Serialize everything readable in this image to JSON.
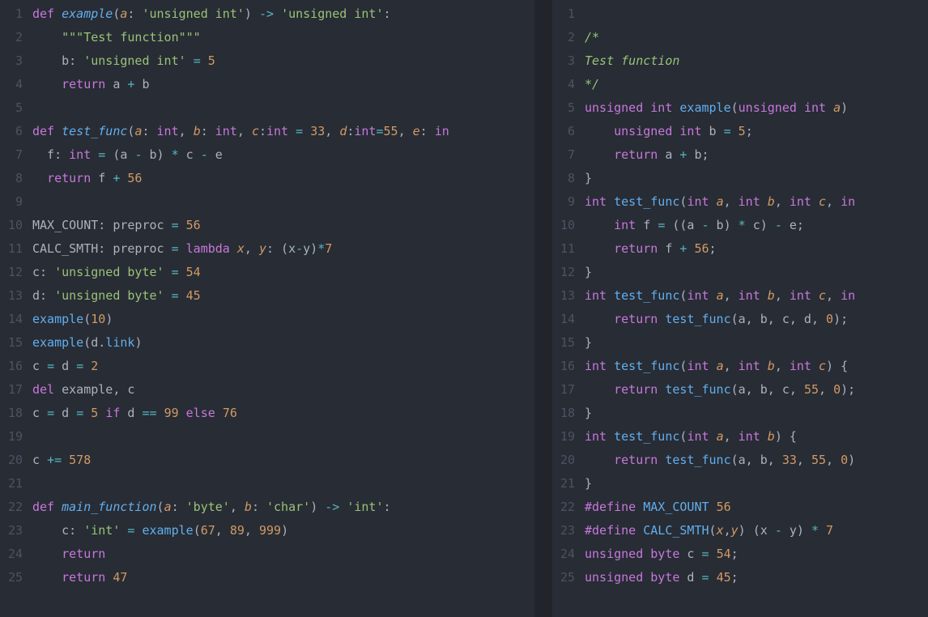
{
  "left": {
    "lang": "python",
    "lines": [
      [
        [
          "kw",
          "def "
        ],
        [
          "fn",
          "example"
        ],
        [
          "var",
          "("
        ],
        [
          "par",
          "a"
        ],
        [
          "var",
          ": "
        ],
        [
          "str",
          "'unsigned int'"
        ],
        [
          "var",
          ") "
        ],
        [
          "op",
          "->"
        ],
        [
          "var",
          " "
        ],
        [
          "str",
          "'unsigned int'"
        ],
        [
          "var",
          ":"
        ]
      ],
      [
        [
          "var",
          "    "
        ],
        [
          "str",
          "\"\"\"Test function\"\"\""
        ]
      ],
      [
        [
          "var",
          "    b: "
        ],
        [
          "str",
          "'unsigned int'"
        ],
        [
          "var",
          " "
        ],
        [
          "op",
          "="
        ],
        [
          "var",
          " "
        ],
        [
          "num",
          "5"
        ]
      ],
      [
        [
          "var",
          "    "
        ],
        [
          "kw",
          "return"
        ],
        [
          "var",
          " a "
        ],
        [
          "op",
          "+"
        ],
        [
          "var",
          " b"
        ]
      ],
      [
        [
          "var",
          ""
        ]
      ],
      [
        [
          "kw",
          "def "
        ],
        [
          "fn",
          "test_func"
        ],
        [
          "var",
          "("
        ],
        [
          "par",
          "a"
        ],
        [
          "var",
          ": "
        ],
        [
          "typ",
          "int"
        ],
        [
          "var",
          ", "
        ],
        [
          "par",
          "b"
        ],
        [
          "var",
          ": "
        ],
        [
          "typ",
          "int"
        ],
        [
          "var",
          ", "
        ],
        [
          "par",
          "c"
        ],
        [
          "var",
          ":"
        ],
        [
          "typ",
          "int"
        ],
        [
          "var",
          " "
        ],
        [
          "op",
          "="
        ],
        [
          "var",
          " "
        ],
        [
          "num",
          "33"
        ],
        [
          "var",
          ", "
        ],
        [
          "par",
          "d"
        ],
        [
          "var",
          ":"
        ],
        [
          "typ",
          "int"
        ],
        [
          "op",
          "="
        ],
        [
          "num",
          "55"
        ],
        [
          "var",
          ", "
        ],
        [
          "par",
          "e"
        ],
        [
          "var",
          ": "
        ],
        [
          "typ",
          "in"
        ]
      ],
      [
        [
          "var",
          "  f: "
        ],
        [
          "typ",
          "int"
        ],
        [
          "var",
          " "
        ],
        [
          "op",
          "="
        ],
        [
          "var",
          " (a "
        ],
        [
          "op",
          "-"
        ],
        [
          "var",
          " b) "
        ],
        [
          "op",
          "*"
        ],
        [
          "var",
          " c "
        ],
        [
          "op",
          "-"
        ],
        [
          "var",
          " e"
        ]
      ],
      [
        [
          "var",
          "  "
        ],
        [
          "kw",
          "return"
        ],
        [
          "var",
          " f "
        ],
        [
          "op",
          "+"
        ],
        [
          "var",
          " "
        ],
        [
          "num",
          "56"
        ]
      ],
      [
        [
          "var",
          ""
        ]
      ],
      [
        [
          "var",
          "MAX_COUNT: preproc "
        ],
        [
          "op",
          "="
        ],
        [
          "var",
          " "
        ],
        [
          "num",
          "56"
        ]
      ],
      [
        [
          "var",
          "CALC_SMTH: preproc "
        ],
        [
          "op",
          "="
        ],
        [
          "var",
          " "
        ],
        [
          "kw",
          "lambda"
        ],
        [
          "var",
          " "
        ],
        [
          "par",
          "x"
        ],
        [
          "var",
          ", "
        ],
        [
          "par",
          "y"
        ],
        [
          "var",
          ": (x"
        ],
        [
          "op",
          "-"
        ],
        [
          "var",
          "y)"
        ],
        [
          "op",
          "*"
        ],
        [
          "num",
          "7"
        ]
      ],
      [
        [
          "var",
          "c: "
        ],
        [
          "str",
          "'unsigned byte'"
        ],
        [
          "var",
          " "
        ],
        [
          "op",
          "="
        ],
        [
          "var",
          " "
        ],
        [
          "num",
          "54"
        ]
      ],
      [
        [
          "var",
          "d: "
        ],
        [
          "str",
          "'unsigned byte'"
        ],
        [
          "var",
          " "
        ],
        [
          "op",
          "="
        ],
        [
          "var",
          " "
        ],
        [
          "num",
          "45"
        ]
      ],
      [
        [
          "call",
          "example"
        ],
        [
          "var",
          "("
        ],
        [
          "num",
          "10"
        ],
        [
          "var",
          ")"
        ]
      ],
      [
        [
          "call",
          "example"
        ],
        [
          "var",
          "(d."
        ],
        [
          "call",
          "link"
        ],
        [
          "var",
          ")"
        ]
      ],
      [
        [
          "var",
          "c "
        ],
        [
          "op",
          "="
        ],
        [
          "var",
          " d "
        ],
        [
          "op",
          "="
        ],
        [
          "var",
          " "
        ],
        [
          "num",
          "2"
        ]
      ],
      [
        [
          "kw",
          "del"
        ],
        [
          "var",
          " example, c"
        ]
      ],
      [
        [
          "var",
          "c "
        ],
        [
          "op",
          "="
        ],
        [
          "var",
          " d "
        ],
        [
          "op",
          "="
        ],
        [
          "var",
          " "
        ],
        [
          "num",
          "5"
        ],
        [
          "var",
          " "
        ],
        [
          "kw",
          "if"
        ],
        [
          "var",
          " d "
        ],
        [
          "op",
          "=="
        ],
        [
          "var",
          " "
        ],
        [
          "num",
          "99"
        ],
        [
          "var",
          " "
        ],
        [
          "kw",
          "else"
        ],
        [
          "var",
          " "
        ],
        [
          "num",
          "76"
        ]
      ],
      [
        [
          "var",
          ""
        ]
      ],
      [
        [
          "var",
          "c "
        ],
        [
          "op",
          "+="
        ],
        [
          "var",
          " "
        ],
        [
          "num",
          "578"
        ]
      ],
      [
        [
          "var",
          ""
        ]
      ],
      [
        [
          "kw",
          "def "
        ],
        [
          "fn",
          "main_function"
        ],
        [
          "var",
          "("
        ],
        [
          "par",
          "a"
        ],
        [
          "var",
          ": "
        ],
        [
          "str",
          "'byte'"
        ],
        [
          "var",
          ", "
        ],
        [
          "par",
          "b"
        ],
        [
          "var",
          ": "
        ],
        [
          "str",
          "'char'"
        ],
        [
          "var",
          ") "
        ],
        [
          "op",
          "->"
        ],
        [
          "var",
          " "
        ],
        [
          "str",
          "'int'"
        ],
        [
          "var",
          ":"
        ]
      ],
      [
        [
          "var",
          "    c: "
        ],
        [
          "str",
          "'int'"
        ],
        [
          "var",
          " "
        ],
        [
          "op",
          "="
        ],
        [
          "var",
          " "
        ],
        [
          "call",
          "example"
        ],
        [
          "var",
          "("
        ],
        [
          "num",
          "67"
        ],
        [
          "var",
          ", "
        ],
        [
          "num",
          "89"
        ],
        [
          "var",
          ", "
        ],
        [
          "num",
          "999"
        ],
        [
          "var",
          ")"
        ]
      ],
      [
        [
          "var",
          "    "
        ],
        [
          "kw",
          "return"
        ]
      ],
      [
        [
          "var",
          "    "
        ],
        [
          "kw",
          "return"
        ],
        [
          "var",
          " "
        ],
        [
          "num",
          "47"
        ]
      ]
    ]
  },
  "right": {
    "lang": "c",
    "lines": [
      [
        [
          "var",
          ""
        ]
      ],
      [
        [
          "cmt2",
          "/*"
        ]
      ],
      [
        [
          "cmt2",
          "Test function"
        ]
      ],
      [
        [
          "cmt2",
          "*/"
        ]
      ],
      [
        [
          "typ",
          "unsigned"
        ],
        [
          "var",
          " "
        ],
        [
          "typ",
          "int"
        ],
        [
          "var",
          " "
        ],
        [
          "fn2",
          "example"
        ],
        [
          "var",
          "("
        ],
        [
          "typ",
          "unsigned"
        ],
        [
          "var",
          " "
        ],
        [
          "typ",
          "int"
        ],
        [
          "var",
          " "
        ],
        [
          "par",
          "a"
        ],
        [
          "var",
          ") "
        ]
      ],
      [
        [
          "var",
          "    "
        ],
        [
          "typ",
          "unsigned"
        ],
        [
          "var",
          " "
        ],
        [
          "typ",
          "int"
        ],
        [
          "var",
          " b "
        ],
        [
          "op",
          "="
        ],
        [
          "var",
          " "
        ],
        [
          "num",
          "5"
        ],
        [
          "var",
          ";"
        ]
      ],
      [
        [
          "var",
          "    "
        ],
        [
          "kw",
          "return"
        ],
        [
          "var",
          " a "
        ],
        [
          "op",
          "+"
        ],
        [
          "var",
          " b;"
        ]
      ],
      [
        [
          "var",
          "}"
        ]
      ],
      [
        [
          "typ",
          "int"
        ],
        [
          "var",
          " "
        ],
        [
          "fn2",
          "test_func"
        ],
        [
          "var",
          "("
        ],
        [
          "typ",
          "int"
        ],
        [
          "var",
          " "
        ],
        [
          "par",
          "a"
        ],
        [
          "var",
          ", "
        ],
        [
          "typ",
          "int"
        ],
        [
          "var",
          " "
        ],
        [
          "par",
          "b"
        ],
        [
          "var",
          ", "
        ],
        [
          "typ",
          "int"
        ],
        [
          "var",
          " "
        ],
        [
          "par",
          "c"
        ],
        [
          "var",
          ", "
        ],
        [
          "typ",
          "in"
        ]
      ],
      [
        [
          "var",
          "    "
        ],
        [
          "typ",
          "int"
        ],
        [
          "var",
          " f "
        ],
        [
          "op",
          "="
        ],
        [
          "var",
          " ((a "
        ],
        [
          "op",
          "-"
        ],
        [
          "var",
          " b) "
        ],
        [
          "op",
          "*"
        ],
        [
          "var",
          " c) "
        ],
        [
          "op",
          "-"
        ],
        [
          "var",
          " e;"
        ]
      ],
      [
        [
          "var",
          "    "
        ],
        [
          "kw",
          "return"
        ],
        [
          "var",
          " f "
        ],
        [
          "op",
          "+"
        ],
        [
          "var",
          " "
        ],
        [
          "num",
          "56"
        ],
        [
          "var",
          ";"
        ]
      ],
      [
        [
          "var",
          "}"
        ]
      ],
      [
        [
          "typ",
          "int"
        ],
        [
          "var",
          " "
        ],
        [
          "fn2",
          "test_func"
        ],
        [
          "var",
          "("
        ],
        [
          "typ",
          "int"
        ],
        [
          "var",
          " "
        ],
        [
          "par",
          "a"
        ],
        [
          "var",
          ", "
        ],
        [
          "typ",
          "int"
        ],
        [
          "var",
          " "
        ],
        [
          "par",
          "b"
        ],
        [
          "var",
          ", "
        ],
        [
          "typ",
          "int"
        ],
        [
          "var",
          " "
        ],
        [
          "par",
          "c"
        ],
        [
          "var",
          ", "
        ],
        [
          "typ",
          "in"
        ]
      ],
      [
        [
          "var",
          "    "
        ],
        [
          "kw",
          "return"
        ],
        [
          "var",
          " "
        ],
        [
          "call",
          "test_func"
        ],
        [
          "var",
          "(a, b, c, d, "
        ],
        [
          "num",
          "0"
        ],
        [
          "var",
          ");"
        ]
      ],
      [
        [
          "var",
          "}"
        ]
      ],
      [
        [
          "typ",
          "int"
        ],
        [
          "var",
          " "
        ],
        [
          "fn2",
          "test_func"
        ],
        [
          "var",
          "("
        ],
        [
          "typ",
          "int"
        ],
        [
          "var",
          " "
        ],
        [
          "par",
          "a"
        ],
        [
          "var",
          ", "
        ],
        [
          "typ",
          "int"
        ],
        [
          "var",
          " "
        ],
        [
          "par",
          "b"
        ],
        [
          "var",
          ", "
        ],
        [
          "typ",
          "int"
        ],
        [
          "var",
          " "
        ],
        [
          "par",
          "c"
        ],
        [
          "var",
          ") {"
        ]
      ],
      [
        [
          "var",
          "    "
        ],
        [
          "kw",
          "return"
        ],
        [
          "var",
          " "
        ],
        [
          "call",
          "test_func"
        ],
        [
          "var",
          "(a, b, c, "
        ],
        [
          "num",
          "55"
        ],
        [
          "var",
          ", "
        ],
        [
          "num",
          "0"
        ],
        [
          "var",
          ");"
        ]
      ],
      [
        [
          "var",
          "}"
        ]
      ],
      [
        [
          "typ",
          "int"
        ],
        [
          "var",
          " "
        ],
        [
          "fn2",
          "test_func"
        ],
        [
          "var",
          "("
        ],
        [
          "typ",
          "int"
        ],
        [
          "var",
          " "
        ],
        [
          "par",
          "a"
        ],
        [
          "var",
          ", "
        ],
        [
          "typ",
          "int"
        ],
        [
          "var",
          " "
        ],
        [
          "par",
          "b"
        ],
        [
          "var",
          ") {"
        ]
      ],
      [
        [
          "var",
          "    "
        ],
        [
          "kw",
          "return"
        ],
        [
          "var",
          " "
        ],
        [
          "call",
          "test_func"
        ],
        [
          "var",
          "(a, b, "
        ],
        [
          "num",
          "33"
        ],
        [
          "var",
          ", "
        ],
        [
          "num",
          "55"
        ],
        [
          "var",
          ", "
        ],
        [
          "num",
          "0"
        ],
        [
          "var",
          ")"
        ]
      ],
      [
        [
          "var",
          "}"
        ]
      ],
      [
        [
          "pp",
          "#define"
        ],
        [
          "var",
          " "
        ],
        [
          "mac",
          "MAX_COUNT"
        ],
        [
          "var",
          " "
        ],
        [
          "num",
          "56"
        ]
      ],
      [
        [
          "pp",
          "#define"
        ],
        [
          "var",
          " "
        ],
        [
          "mac",
          "CALC_SMTH"
        ],
        [
          "var",
          "("
        ],
        [
          "par",
          "x"
        ],
        [
          "var",
          ","
        ],
        [
          "par",
          "y"
        ],
        [
          "var",
          ") (x "
        ],
        [
          "op",
          "-"
        ],
        [
          "var",
          " y) "
        ],
        [
          "op",
          "*"
        ],
        [
          "var",
          " "
        ],
        [
          "num",
          "7"
        ]
      ],
      [
        [
          "typ",
          "unsigned"
        ],
        [
          "var",
          " "
        ],
        [
          "typ",
          "byte"
        ],
        [
          "var",
          " c "
        ],
        [
          "op",
          "="
        ],
        [
          "var",
          " "
        ],
        [
          "num",
          "54"
        ],
        [
          "var",
          ";"
        ]
      ],
      [
        [
          "typ",
          "unsigned"
        ],
        [
          "var",
          " "
        ],
        [
          "typ",
          "byte"
        ],
        [
          "var",
          " d "
        ],
        [
          "op",
          "="
        ],
        [
          "var",
          " "
        ],
        [
          "num",
          "45"
        ],
        [
          "var",
          ";"
        ]
      ]
    ]
  }
}
